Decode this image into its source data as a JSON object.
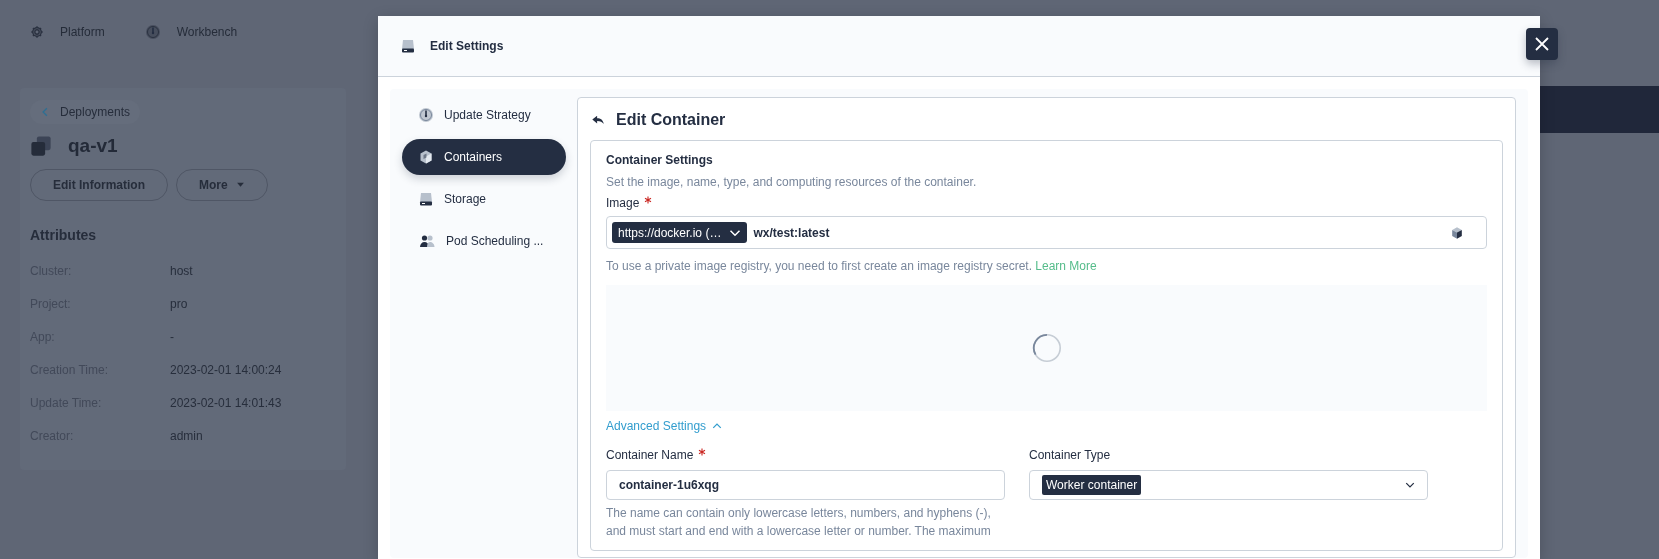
{
  "top_nav": [
    {
      "label": "Platform"
    },
    {
      "label": "Workbench"
    }
  ],
  "detail": {
    "back_link": "Deployments",
    "name": "qa-v1",
    "actions": [
      {
        "label": "Edit Information",
        "kind": "button"
      },
      {
        "label": "More",
        "kind": "dropdown"
      }
    ],
    "attributes_title": "Attributes",
    "attributes": [
      {
        "label": "Cluster:",
        "value": "host"
      },
      {
        "label": "Project:",
        "value": "pro"
      },
      {
        "label": "App:",
        "value": "-"
      },
      {
        "label": "Creation Time:",
        "value": "2023-02-01 14:00:24"
      },
      {
        "label": "Update Time:",
        "value": "2023-02-01 14:01:43"
      },
      {
        "label": "Creator:",
        "value": "admin"
      }
    ]
  },
  "modal": {
    "title": "Edit Settings",
    "nav": [
      {
        "label": "Update Strategy",
        "selected": false
      },
      {
        "label": "Containers",
        "selected": true
      },
      {
        "label": "Storage",
        "selected": false
      },
      {
        "label": "Pod Scheduling ...",
        "selected": false
      }
    ],
    "panel_title": "Edit Container",
    "section": {
      "title": "Container Settings",
      "description": "Set the image, name, type, and computing resources of the container.",
      "image": {
        "label": "Image",
        "required": true,
        "registry": "https://docker.io (…",
        "value": "wx/test:latest"
      },
      "image_help": "To use a private image registry, you need to first create an image registry secret.",
      "image_help_link": "Learn More",
      "loading": true,
      "advanced_label": "Advanced Settings",
      "advanced_expanded": true,
      "fields": [
        {
          "kind": "input",
          "label": "Container Name",
          "required": true,
          "value": "container-1u6xqg",
          "help": "The name can contain only lowercase letters, numbers, and hyphens (-), and must start and end with a lowercase letter or number. The maximum"
        },
        {
          "kind": "select",
          "label": "Container Type",
          "required": false,
          "value": "Worker container"
        }
      ]
    }
  }
}
